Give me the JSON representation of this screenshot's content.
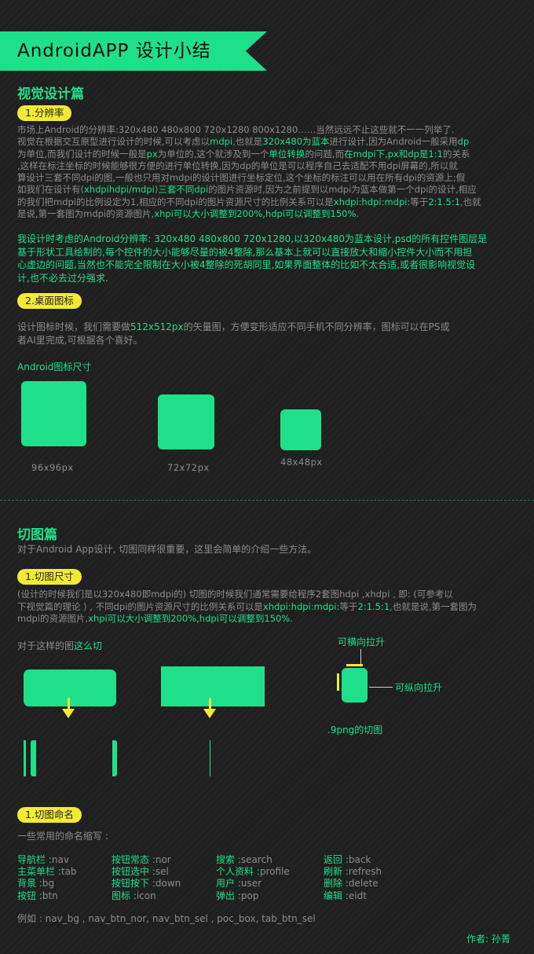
{
  "header": {
    "title": "AndroidAPP 设计小结"
  },
  "visual": {
    "title": "视觉设计篇",
    "resolution": {
      "pill": "1.分辨率",
      "p1_lines": [
        [
          {
            "t": "市场上Android的分辨率:320x480  480x800  720x1280  800x1280……当然远远不止这些就不一一列举了.",
            "g": false
          }
        ],
        [
          {
            "t": "视觉在根据交互原型进行设计的时候,可以考虑以",
            "g": false
          },
          {
            "t": "mdpi",
            "g": true
          },
          {
            "t": ",也就是",
            "g": false
          },
          {
            "t": "320x480为蓝本",
            "g": true
          },
          {
            "t": "进行设计,因为Android一般采用",
            "g": false
          },
          {
            "t": "dp",
            "g": true
          }
        ],
        [
          {
            "t": "为单位,而我们设计的时候一般是",
            "g": false
          },
          {
            "t": "px",
            "g": true
          },
          {
            "t": "为单位的,这个就涉及到一个",
            "g": false
          },
          {
            "t": "单位转换",
            "g": true
          },
          {
            "t": "的问题,而",
            "g": false
          },
          {
            "t": "在mdpi下,px和dp是1:1",
            "g": true
          },
          {
            "t": "的关系",
            "g": false
          }
        ],
        [
          {
            "t": ",这样在标注坐标的时候能够很方便的进行单位转换,因为dp的单位是可以程序自己去适配不用dpi屏幕的,所以就",
            "g": false
          }
        ],
        [
          {
            "t": "算设计三套不同dpi的图,一般也只用对mdpi的设计图进行坐标定位,这个坐标的标注可以用在所有dpi的资源上;假",
            "g": false
          }
        ],
        [
          {
            "t": "如我们在设计有(",
            "g": false
          },
          {
            "t": "xhdpihdpi/mdpi",
            "g": true
          },
          {
            "t": ")",
            "g": false
          },
          {
            "t": "三套不同dpi",
            "g": true
          },
          {
            "t": "的图片资源时,因为之前提到以mdpi为蓝本做第一个dpi的设计,相应",
            "g": false
          }
        ],
        [
          {
            "t": "的我们把mdpi的比例设定为1,相应的不同dpi的图片资源尺寸的比例关系可以是",
            "g": false
          },
          {
            "t": "xhdpi:hdpi:mdpi:",
            "g": true
          },
          {
            "t": "等于",
            "g": false
          },
          {
            "t": "2:1.5:1",
            "g": true
          },
          {
            "t": ",也就",
            "g": false
          }
        ],
        [
          {
            "t": "是说,第一套图为mdpi的资源图片,",
            "g": false
          },
          {
            "t": "xhpi可以大小调整到200%,hdpi可以调整到150%.",
            "g": true
          }
        ]
      ],
      "p2_lines": [
        "我设计时考虑的Android分辨率: 320x480     480x800    720x1280,以320x480为蓝本设计,psd的所有控件图层是",
        "基于形状工具绘制的,每个控件的大小能够尽量的被4整除,那么基本上就可以直接放大和缩小控件大小而不用担",
        "心虚边的问题,当然也不能完全限制在大小被4整除的死胡同里,如果界面整体的比如不太合适,或者很影响视觉设",
        "计,也不必去过分强求."
      ]
    },
    "icon": {
      "pill": "2.桌面图标",
      "p_lines": [
        [
          {
            "t": "设计图标时候，我们需要做",
            "g": false
          },
          {
            "t": "512x512px",
            "g": true
          },
          {
            "t": "的矢量图，方便变形适应不同手机不同分辨率，图标可以在PS或",
            "g": false
          }
        ],
        [
          {
            "t": "者AI里完成,可根据各个喜好。",
            "g": false
          }
        ]
      ],
      "sizes_title": "Android图标尺寸",
      "sizes": [
        "96x96px",
        "72x72px",
        "48x48px"
      ]
    }
  },
  "cut": {
    "title": "切图篇",
    "intro": "对于Android App设计, 切图同样很重要，这里会简单的介绍一些方法。",
    "size": {
      "pill": "1.切图尺寸",
      "p_lines": [
        [
          {
            "t": "(设计的时候我们是以320x480即mdpi的) 切图的时候我们通常需要给程序2套图hdpi ,xhdpi , 即: (可参考以",
            "g": false
          }
        ],
        [
          {
            "t": "下视觉篇的理论 ) , 不同dpi的图片资源尺寸的比例关系可以是",
            "g": false
          },
          {
            "t": "xhdpi:hdpi:mdpi:",
            "g": true
          },
          {
            "t": "等于",
            "g": false
          },
          {
            "t": "2:1.5:1",
            "g": true
          },
          {
            "t": ",也就是说,第一套图为",
            "g": false
          }
        ],
        [
          {
            "t": "mdpi的资源图片,",
            "g": false
          },
          {
            "t": "xhpi可以大小调整到200%,hdpi可以调整到150%.",
            "g": true
          }
        ]
      ],
      "how_prefix": "对于这样的图",
      "how_green": "这么切",
      "stretch_h": "可横向拉升",
      "stretch_v": "可纵向拉升",
      "ninepatch": ".9png的切图"
    },
    "naming": {
      "pill": "1.切图命名",
      "sub": "一些常用的命名缩写 :",
      "rows": [
        [
          [
            "导航栏 :",
            "nav"
          ],
          [
            "按钮常态 :",
            "nor"
          ],
          [
            "搜索 :",
            "search"
          ],
          [
            "返回 :",
            "back"
          ]
        ],
        [
          [
            "主菜单栏 :",
            "tab"
          ],
          [
            "按钮选中 :",
            "sel"
          ],
          [
            "个人资料 :",
            "profile"
          ],
          [
            "刷新 :",
            "refresh"
          ]
        ],
        [
          [
            "背景 :",
            "bg"
          ],
          [
            "按钮按下 :",
            "down"
          ],
          [
            "用户 :",
            "user"
          ],
          [
            "删除 :",
            "delete"
          ]
        ],
        [
          [
            "按钮 :",
            "btn"
          ],
          [
            "图标 :",
            "icon"
          ],
          [
            "弹出 :",
            "pop"
          ],
          [
            "编辑 :",
            "eidt"
          ]
        ]
      ],
      "example": "例如 : nav_bg  ,  nav_btn_nor,   nav_btn_sel ,  poc_box,   tab_btn_sel"
    }
  },
  "author": "作者: 孙菁",
  "colors": {
    "accent": "#1ee08a",
    "highlight": "#f3ea35",
    "bg": "#1f1f1f"
  }
}
